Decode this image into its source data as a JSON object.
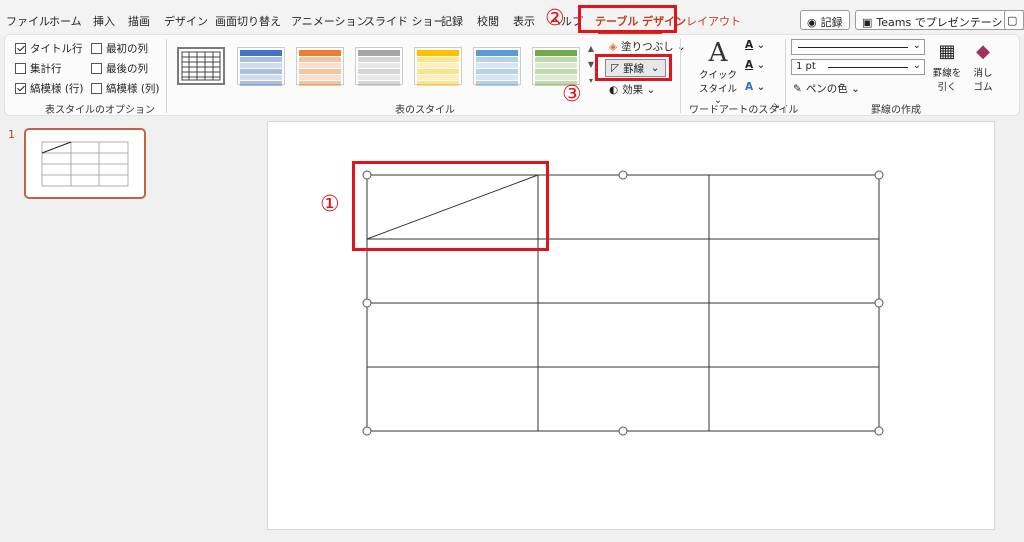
{
  "menu": {
    "tabs": [
      "ファイル",
      "ホーム",
      "挿入",
      "描画",
      "デザイン",
      "画面切り替え",
      "アニメーション",
      "スライド ショー",
      "記録",
      "校閲",
      "表示",
      "ヘルプ"
    ],
    "active_tab": "テーブル デザイン",
    "layout_tab": "レイアウト",
    "record_button": "記録",
    "teams_button": "Teams でプレゼンテーション"
  },
  "ribbon": {
    "style_options": {
      "header_row": "タイトル行",
      "first_column": "最初の列",
      "total_row": "集計行",
      "last_column": "最後の列",
      "banded_rows": "縞模様 (行)",
      "banded_columns": "縞模様 (列)",
      "header_row_checked": true,
      "first_column_checked": false,
      "total_row_checked": false,
      "last_column_checked": false,
      "banded_rows_checked": true,
      "banded_columns_checked": false,
      "label": "表スタイルのオプション"
    },
    "table_styles": {
      "label": "表のスタイル",
      "swatch_colors": [
        "#4472c4",
        "#ed7d31",
        "#a5a5a5",
        "#ffc000",
        "#5b9bd5",
        "#70ad47"
      ],
      "shading": "塗りつぶし",
      "borders": "罫線",
      "effects": "効果"
    },
    "wordart": {
      "quick_styles": "クイック",
      "quick_styles_2": "スタイル",
      "label": "ワードアートのスタイル"
    },
    "draw_borders": {
      "pen_weight": "1 pt",
      "pen_color": "ペンの色",
      "draw_table": "罫線を",
      "draw_table_2": "引く",
      "eraser": "消し",
      "eraser_2": "ゴム",
      "label": "罫線の作成"
    }
  },
  "thumbnail": {
    "number": "1"
  },
  "annotations": {
    "n1": "①",
    "n2": "②",
    "n3": "③"
  }
}
